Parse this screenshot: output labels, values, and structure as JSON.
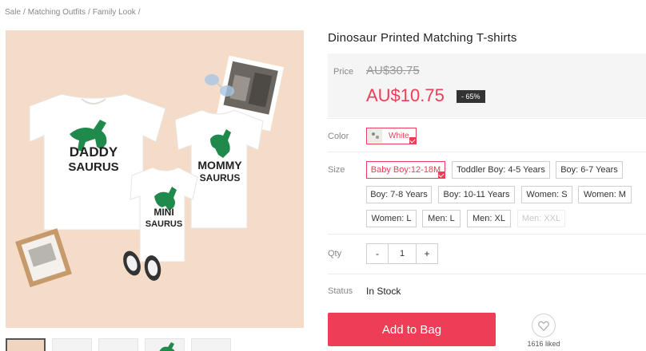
{
  "breadcrumb": [
    "Sale",
    "Matching Outfits",
    "Family Look"
  ],
  "breadcrumb_sep": "/",
  "product": {
    "title": "Dinosaur Printed Matching T-shirts",
    "price_label": "Price",
    "old_price": "AU$30.75",
    "new_price": "AU$10.75",
    "discount": "- 65%"
  },
  "image_text": {
    "daddy_line1": "DADDY",
    "daddy_line2": "SAURUS",
    "mommy_line1": "MOMMY",
    "mommy_line2": "SAURUS",
    "mini_line1": "MINI",
    "mini_line2": "SAURUS"
  },
  "color": {
    "label": "Color",
    "selected": "White"
  },
  "size": {
    "label": "Size",
    "options": [
      {
        "label": "Baby Boy:12-18M",
        "state": "selected"
      },
      {
        "label": "Toddler Boy: 4-5 Years",
        "state": "normal"
      },
      {
        "label": "Boy: 6-7 Years",
        "state": "normal"
      },
      {
        "label": "Boy: 7-8 Years",
        "state": "normal"
      },
      {
        "label": "Boy: 10-11 Years",
        "state": "normal"
      },
      {
        "label": "Women: S",
        "state": "normal"
      },
      {
        "label": "Women: M",
        "state": "normal"
      },
      {
        "label": "Women: L",
        "state": "normal"
      },
      {
        "label": "Men: L",
        "state": "normal"
      },
      {
        "label": "Men: XL",
        "state": "normal"
      },
      {
        "label": "Men: XXL",
        "state": "disabled"
      }
    ]
  },
  "qty": {
    "label": "Qty",
    "minus": "-",
    "value": "1",
    "plus": "+"
  },
  "status": {
    "label": "Status",
    "value": "In Stock"
  },
  "actions": {
    "add_to_bag": "Add to Bag",
    "liked": "1616 liked"
  },
  "colors": {
    "accent": "#ee3d57",
    "price_bg": "#f5f5f5",
    "image_bg": "#f5dcc8",
    "dino_green": "#1f8a4c"
  }
}
